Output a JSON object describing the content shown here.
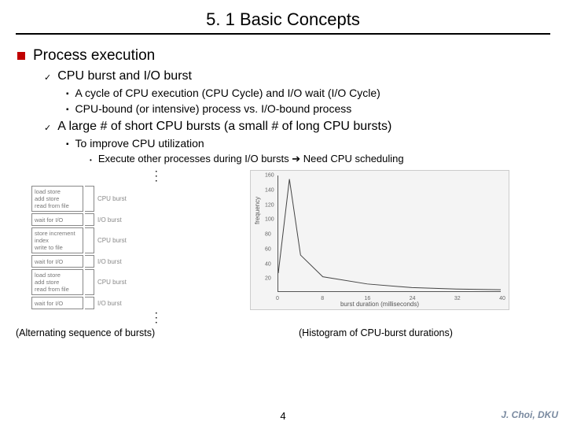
{
  "title": "5. 1 Basic Concepts",
  "h1": "Process execution",
  "b1": {
    "label": "CPU burst",
    "mid": " and ",
    "label2": "I/O burst"
  },
  "b1s1": "A cycle of CPU execution (CPU Cycle) and I/O wait (I/O Cycle)",
  "b1s2": "CPU-bound (or intensive) process vs. I/O-bound process",
  "b2": "A large # of short CPU bursts (a small # of long CPU bursts)",
  "b2s1": "To improve CPU utilization",
  "b2s1a": "Execute other processes during I/O bursts ➔ Need CPU scheduling",
  "fig_left": {
    "box1": [
      "load store",
      "add store",
      "read from file"
    ],
    "box2": [
      "wait for I/O"
    ],
    "box3": [
      "store increment",
      "index",
      "write to file"
    ],
    "box4": [
      "wait for I/O"
    ],
    "box5": [
      "load store",
      "add store",
      "read from file"
    ],
    "box6": [
      "wait for I/O"
    ],
    "lab_cpu": "CPU burst",
    "lab_io": "I/O burst"
  },
  "caption_left": "(Alternating sequence of bursts)",
  "caption_right": "(Histogram of CPU-burst durations)",
  "page_number": "4",
  "credit": "J. Choi, DKU",
  "chart_data": {
    "type": "line",
    "xlabel": "burst duration (milliseconds)",
    "ylabel": "frequency",
    "x": [
      0,
      2,
      4,
      8,
      16,
      24,
      32,
      40
    ],
    "y": [
      25,
      155,
      50,
      20,
      10,
      5,
      3,
      2
    ],
    "xlim": [
      0,
      40
    ],
    "ylim": [
      0,
      160
    ],
    "yticks": [
      20,
      40,
      60,
      80,
      100,
      120,
      140,
      160
    ],
    "xticks": [
      0,
      8,
      16,
      24,
      32,
      40
    ]
  }
}
